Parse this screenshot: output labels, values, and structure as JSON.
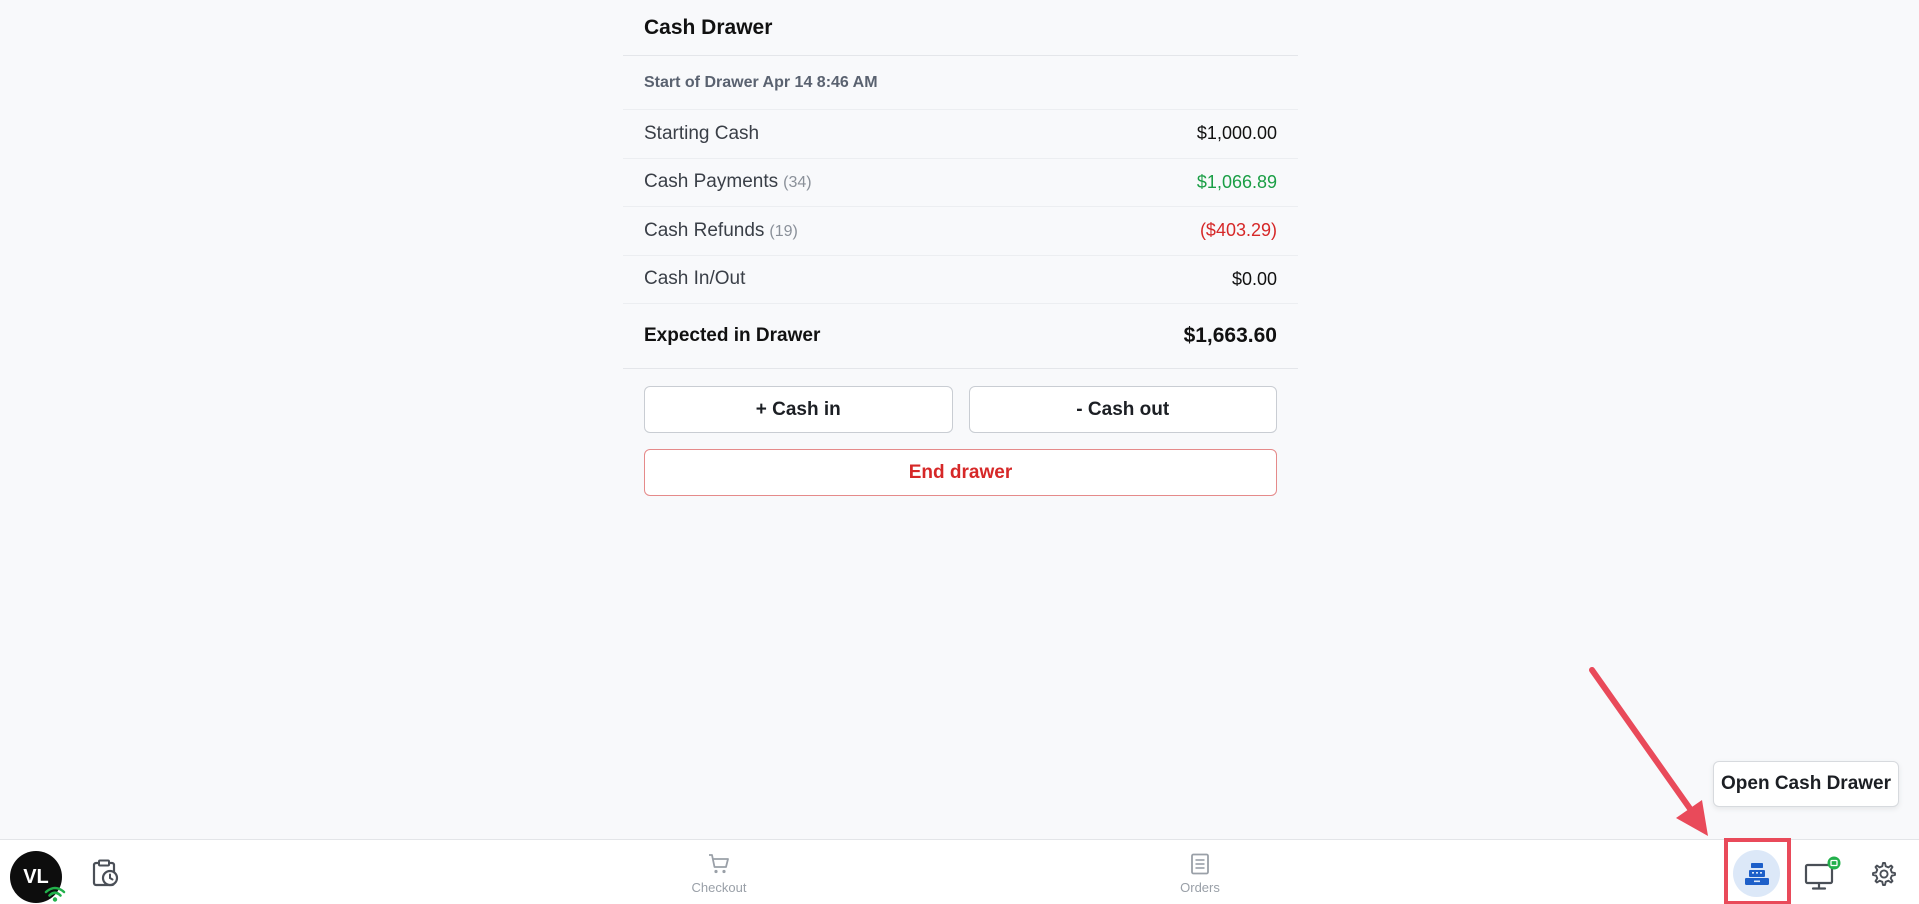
{
  "panel": {
    "title": "Cash Drawer",
    "start_label": "Start of Drawer Apr 14 8:46 AM",
    "rows": [
      {
        "label": "Starting Cash",
        "count": "",
        "value": "$1,000.00"
      },
      {
        "label": "Cash Payments",
        "count": "(34)",
        "value": "$1,066.89"
      },
      {
        "label": "Cash Refunds",
        "count": "(19)",
        "value": "($403.29)"
      },
      {
        "label": "Cash In/Out",
        "count": "",
        "value": "$0.00"
      }
    ],
    "expected_label": "Expected in Drawer",
    "expected_value": "$1,663.60",
    "cash_in_label": "+ Cash in",
    "cash_out_label": "- Cash out",
    "end_drawer_label": "End drawer"
  },
  "bottom_bar": {
    "avatar_initials": "VL",
    "nav": {
      "checkout": "Checkout",
      "orders": "Orders"
    }
  },
  "tooltip": {
    "text": "Open Cash Drawer"
  },
  "colors": {
    "positive": "#1a9e45",
    "negative": "#d62828",
    "highlight": "#e94a5a",
    "drawer_bg": "#dce8f8"
  }
}
